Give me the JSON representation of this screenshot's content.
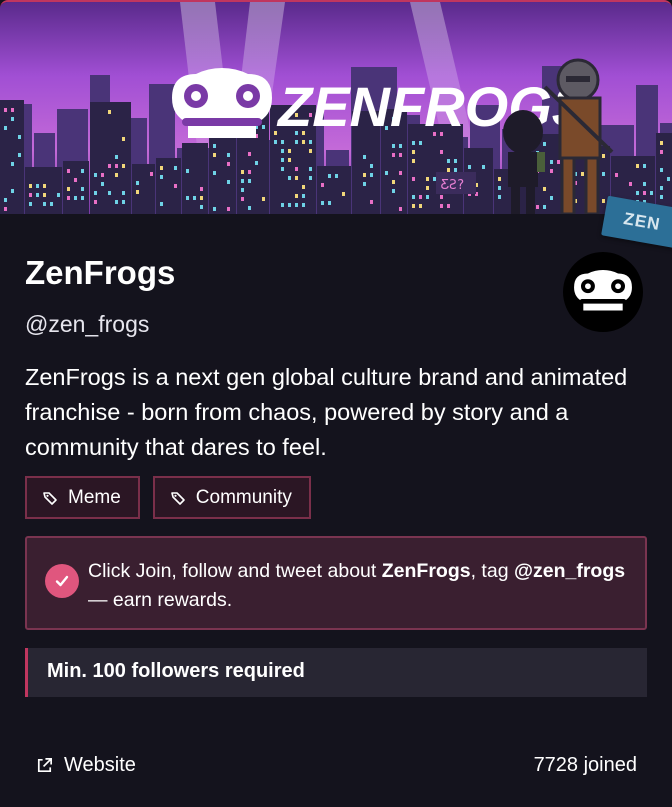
{
  "banner": {
    "logo_text": "ZENFROGS",
    "sticker_text": "ZEN",
    "sign_text": "ƸƧ?"
  },
  "project": {
    "name": "ZenFrogs",
    "handle": "@zen_frogs",
    "description": "ZenFrogs is a next gen global culture brand and animated franchise - born from chaos, powered by story and a community that dares to feel."
  },
  "tags": [
    {
      "label": "Meme",
      "icon": "tag-icon"
    },
    {
      "label": "Community",
      "icon": "tag-icon"
    }
  ],
  "notice": {
    "part1": "Click Join, follow and tweet about ",
    "bold1": "ZenFrogs",
    "part2": ", tag ",
    "bold2": "@zen_frogs",
    "part3": " — earn rewards."
  },
  "requirement": "Min. 100 followers required",
  "footer": {
    "website_label": "Website",
    "joined_text": "7728 joined"
  },
  "colors": {
    "background": "#14131d",
    "accent": "#c0365f",
    "check": "#e0567e",
    "banner_sky": "#9b4fd0"
  }
}
